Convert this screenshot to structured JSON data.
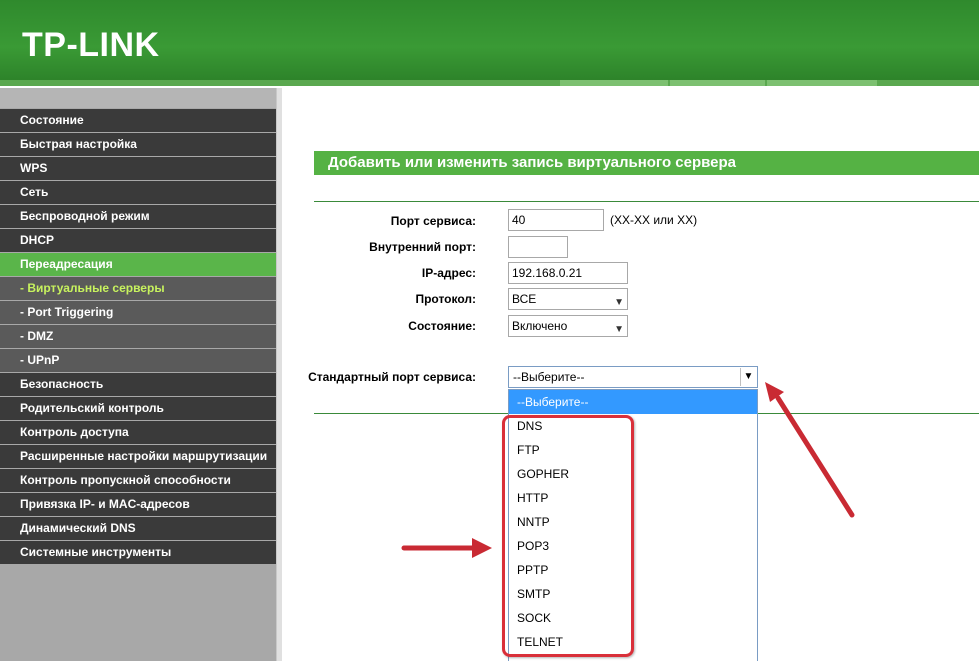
{
  "header": {
    "logo": "TP-LINK"
  },
  "sidebar": {
    "items": [
      {
        "label": "Состояние",
        "type": "main"
      },
      {
        "label": "Быстрая настройка",
        "type": "main"
      },
      {
        "label": "WPS",
        "type": "main"
      },
      {
        "label": "Сеть",
        "type": "main"
      },
      {
        "label": "Беспроводной режим",
        "type": "main"
      },
      {
        "label": "DHCP",
        "type": "main"
      },
      {
        "label": "Переадресация",
        "type": "active"
      },
      {
        "label": "- Виртуальные серверы",
        "type": "sub-current"
      },
      {
        "label": "- Port Triggering",
        "type": "sub"
      },
      {
        "label": "- DMZ",
        "type": "sub"
      },
      {
        "label": "- UPnP",
        "type": "sub"
      },
      {
        "label": "Безопасность",
        "type": "main"
      },
      {
        "label": "Родительский контроль",
        "type": "main"
      },
      {
        "label": "Контроль доступа",
        "type": "main"
      },
      {
        "label": "Расширенные настройки маршрутизации",
        "type": "main"
      },
      {
        "label": "Контроль пропускной способности",
        "type": "main"
      },
      {
        "label": "Привязка IP- и MAC-адресов",
        "type": "main"
      },
      {
        "label": "Динамический DNS",
        "type": "main"
      },
      {
        "label": "Системные инструменты",
        "type": "main"
      }
    ]
  },
  "form": {
    "title": "Добавить или изменить запись виртуального сервера",
    "service_port_label": "Порт сервиса:",
    "service_port_value": "40",
    "service_port_hint": "(XX-XX или XX)",
    "internal_port_label": "Внутренний порт:",
    "internal_port_value": "",
    "ip_label": "IP-адрес:",
    "ip_value": "192.168.0.21",
    "protocol_label": "Протокол:",
    "protocol_value": "ВСЕ",
    "status_label": "Состояние:",
    "status_value": "Включено",
    "std_port_label": "Стандартный порт сервиса:",
    "std_port_value": "--Выберите--"
  },
  "dropdown": {
    "options": [
      "--Выберите--",
      "DNS",
      "FTP",
      "GOPHER",
      "HTTP",
      "NNTP",
      "POP3",
      "PPTP",
      "SMTP",
      "SOCK",
      "TELNET"
    ]
  },
  "colors": {
    "brand_green": "#3a9a35",
    "title_green": "#55b244",
    "annotation_red": "#d9303a",
    "selection_blue": "#3399ff"
  }
}
